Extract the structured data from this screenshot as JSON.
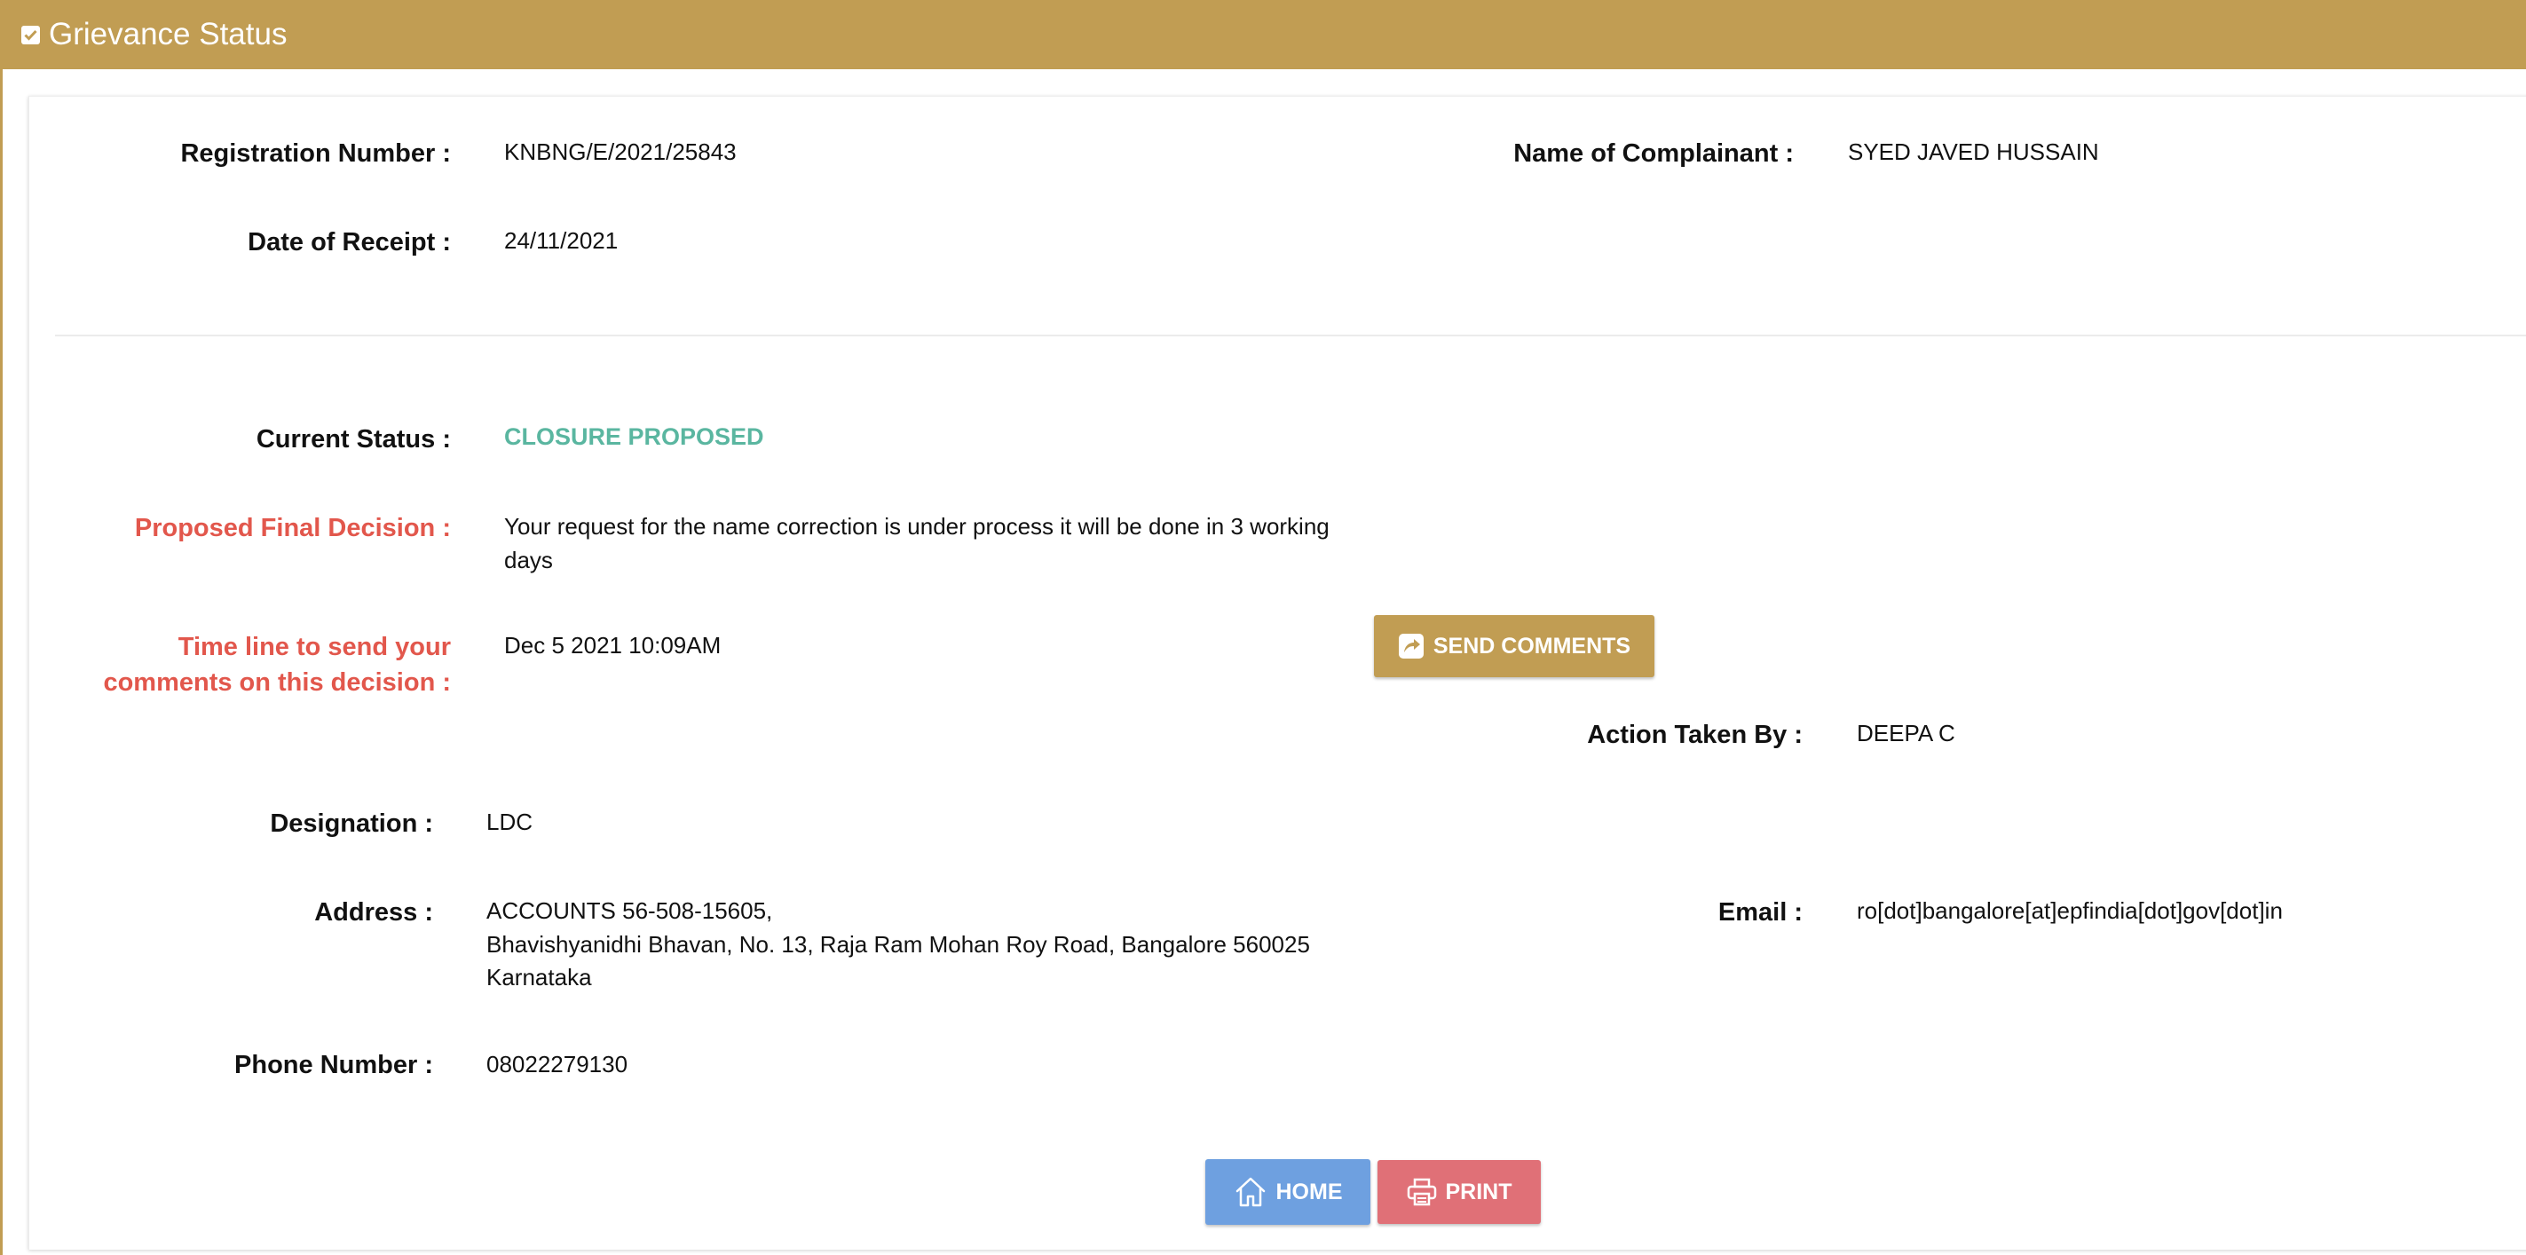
{
  "header": {
    "title": "Grievance Status"
  },
  "fields": {
    "registration_number": {
      "label": "Registration Number :",
      "value": "KNBNG/E/2021/25843"
    },
    "name_of_complainant": {
      "label": "Name of Complainant :",
      "value": "SYED JAVED HUSSAIN"
    },
    "date_of_receipt": {
      "label": "Date of Receipt :",
      "value": "24/11/2021"
    },
    "current_status": {
      "label": "Current Status :",
      "value": "CLOSURE PROPOSED"
    },
    "proposed_final_decision": {
      "label": "Proposed Final Decision :",
      "value_line1": "Your request for the name correction is under process it will be done in 3 working",
      "value_line2": "days"
    },
    "timeline": {
      "label_line1": "Time line to send your",
      "label_line2": "comments on this decision :",
      "value": "Dec 5 2021 10:09AM"
    },
    "action_taken_by": {
      "label": "Action Taken By :",
      "value": "DEEPA C"
    },
    "designation": {
      "label": "Designation :",
      "value": "LDC"
    },
    "address": {
      "label": "Address :",
      "line1": "ACCOUNTS 56-508-15605,",
      "line2": "Bhavishyanidhi Bhavan, No. 13, Raja Ram Mohan Roy Road, Bangalore 560025",
      "line3": "Karnataka"
    },
    "email": {
      "label": "Email :",
      "value": "ro[dot]bangalore[at]epfindia[dot]gov[dot]in"
    },
    "phone_number": {
      "label": "Phone Number :",
      "value": "08022279130"
    }
  },
  "buttons": {
    "send_comments": "SEND COMMENTS",
    "home": "HOME",
    "print": "PRINT"
  },
  "colors": {
    "brand": "#c19d53",
    "status": "#5ab6a0",
    "alert_label": "#e2574c",
    "home_button": "#6ea0e0",
    "print_button": "#e07077"
  },
  "icons": {
    "header": "checkbox-icon",
    "send_comments": "share-icon",
    "home": "home-icon",
    "print": "printer-icon"
  }
}
